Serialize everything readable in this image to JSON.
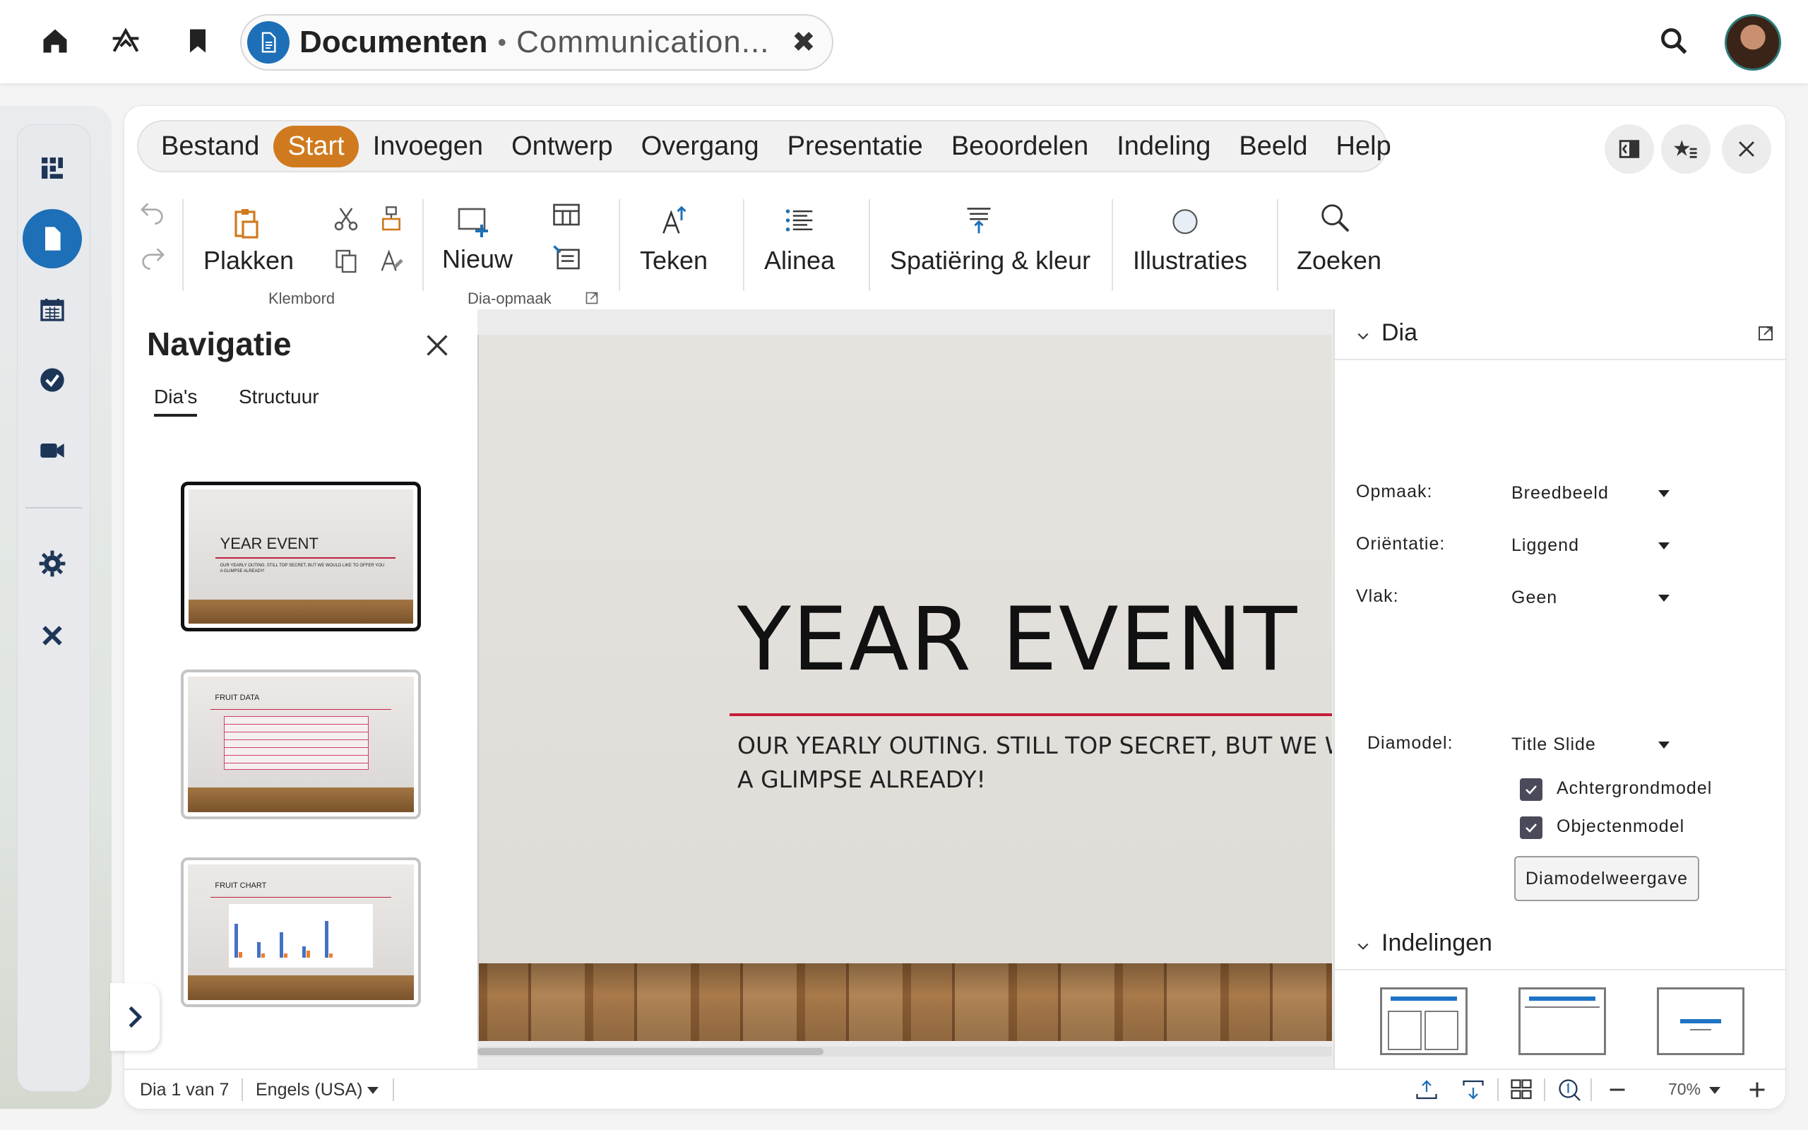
{
  "topbar": {
    "app_name": "Documenten",
    "doc_title": "Communication...",
    "icons": [
      "home-icon",
      "apps-icon",
      "bookmark-icon",
      "search-icon"
    ]
  },
  "menu": {
    "items": [
      "Bestand",
      "Start",
      "Invoegen",
      "Ontwerp",
      "Overgang",
      "Presentatie",
      "Beoordelen",
      "Indeling",
      "Beeld",
      "Help"
    ],
    "active": "Start"
  },
  "ribbon": {
    "paste": "Plakken",
    "clipboard_group": "Klembord",
    "new": "Nieuw",
    "slide_layout_group": "Dia-opmaak",
    "draw": "Teken",
    "paragraph": "Alinea",
    "spacing": "Spatiëring & kleur",
    "illustrations": "Illustraties",
    "find": "Zoeken"
  },
  "navigation": {
    "title": "Navigatie",
    "tabs": [
      "Dia's",
      "Structuur"
    ],
    "thumbs": [
      {
        "title": "YEAR EVENT",
        "sub": "OUR YEARLY OUTING. STILL TOP SECRET, BUT WE WOULD LIKE TO OFFER YOU A GLIMPSE ALREADY!"
      },
      {
        "title": "FRUIT DATA"
      },
      {
        "title": "FRUIT CHART"
      }
    ]
  },
  "slide": {
    "title": "YEAR EVENT",
    "subtitle_line1": "OUR YEARLY OUTING. STILL TOP SECRET, BUT WE WOU",
    "subtitle_line2": "A GLIMPSE ALREADY!"
  },
  "sidebar": {
    "slide_section": "Dia",
    "format_label": "Opmaak:",
    "format_value": "Breedbeeld",
    "orientation_label": "Oriëntatie:",
    "orientation_value": "Liggend",
    "fill_label": "Vlak:",
    "fill_value": "Geen",
    "master_label": "Diamodel:",
    "master_value": "Title Slide",
    "bg_master": "Achtergrondmodel",
    "obj_master": "Objectenmodel",
    "master_view_button": "Diamodelweergave",
    "layouts_section": "Indelingen"
  },
  "status": {
    "slide_pos": "Dia 1 van 7",
    "language": "Engels (USA)",
    "zoom": "70%"
  },
  "colors": {
    "accent_orange": "#d07a1f",
    "brand_blue": "#1d6fb8",
    "slide_rule_red": "#c41e3a"
  }
}
